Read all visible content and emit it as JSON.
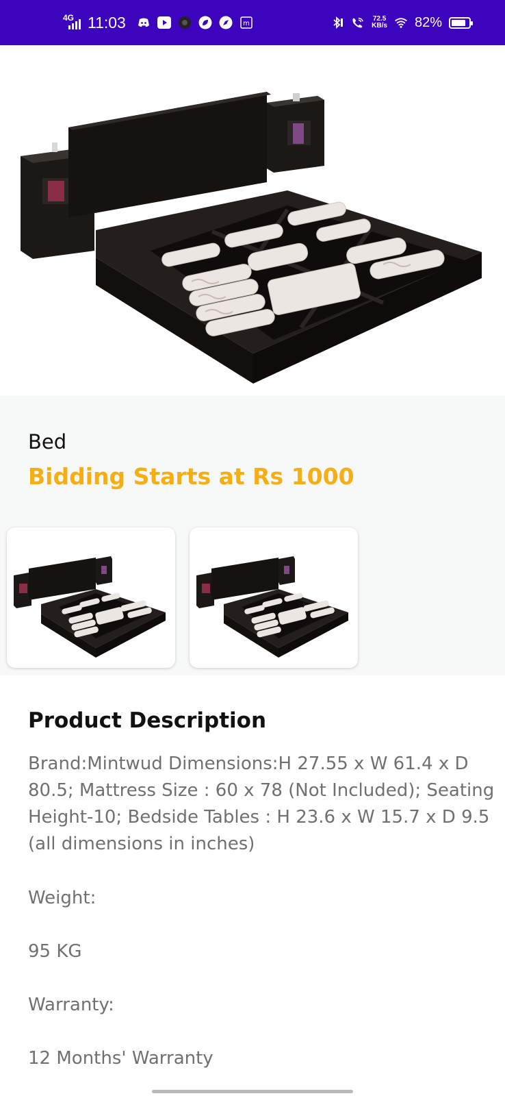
{
  "status_bar": {
    "network": "4G",
    "time": "11:03",
    "speed_value": "72.5",
    "speed_unit": "KB/s",
    "battery": "82%",
    "battery_level": 0.82
  },
  "product": {
    "name": "Bed",
    "bid_text": "Bidding Starts at Rs 1000"
  },
  "description": {
    "title": "Product Description",
    "text": "Brand:Mintwud Dimensions:H 27.55 x W 61.4 x D 80.5; Mattress Size : 60 x 78 (Not Included); Seating Height-10; Bedside Tables : H 23.6 x W 15.7 x D 9.5 (all dimensions in inches)",
    "weight_label": "Weight:",
    "weight_value": "95 KG",
    "warranty_label": "Warranty:",
    "warranty_value": "12 Months' Warranty"
  },
  "colors": {
    "status_bar": "#3c05bd",
    "accent": "#f5ae14",
    "body_text": "#707070"
  }
}
